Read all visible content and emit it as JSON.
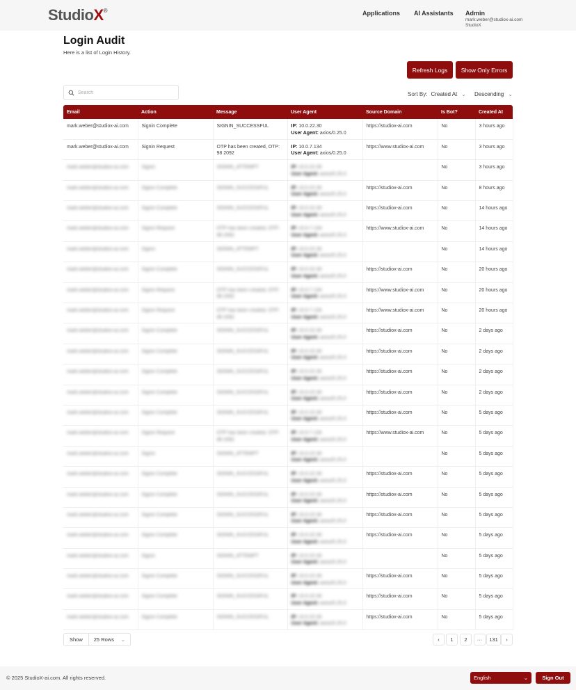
{
  "header": {
    "logo_main": "Studio",
    "logo_x": "X",
    "logo_mark": "®",
    "nav": [
      "Applications",
      "AI Assistants"
    ],
    "user": {
      "name": "Admin",
      "email": "mark.weber@studiox-ai.com",
      "org": "StudioX"
    }
  },
  "page": {
    "title": "Login Audit",
    "subtitle": "Here is a list of Login History.",
    "refresh_label": "Refresh Logs",
    "errors_label": "Show Only Errors",
    "search_placeholder": "Search",
    "sort_label": "Sort By:",
    "sort_field": "Created At",
    "sort_order": "Descending"
  },
  "table": {
    "columns": [
      "Email",
      "Action",
      "Message",
      "User Agent",
      "Source Domain",
      "Is Bot?",
      "Created At"
    ],
    "ip_label": "IP:",
    "ua_label": "User Agent:",
    "rows": [
      {
        "email": "mark.weber@studiox-ai.com",
        "action": "Signin Complete",
        "message": "SIGNIN_SUCCESSFUL",
        "ip": "10.0.22.30",
        "agent": "axios/0.25.0",
        "domain": "https://studiox-ai.com",
        "bot": "No",
        "created": "3 hours ago"
      },
      {
        "email": "mark.weber@studiox-ai.com",
        "action": "Signin Request",
        "message": "OTP has been created, OTP: 98 2092",
        "ip": "10.0.7.134",
        "agent": "axios/0.25.0",
        "domain": "https://www.studiox-ai.com",
        "bot": "No",
        "created": "3 hours ago"
      },
      {
        "email": "mark.weber@studiox-ai.com",
        "action": "Signin",
        "message": "SIGNIN_ATTEMPT",
        "ip": "10.0.22.30",
        "agent": "axios/0.25.0",
        "domain": "",
        "bot": "No",
        "created": "3 hours ago"
      },
      {
        "email": "mark.weber@studiox-ai.com",
        "action": "Signin Complete",
        "message": "SIGNIN_SUCCESSFUL",
        "ip": "10.0.22.30",
        "agent": "axios/0.25.0",
        "domain": "https://studiox-ai.com",
        "bot": "No",
        "created": "8 hours ago"
      },
      {
        "email": "mark.weber@studiox-ai.com",
        "action": "Signin Complete",
        "message": "SIGNIN_SUCCESSFUL",
        "ip": "10.0.22.30",
        "agent": "axios/0.25.0",
        "domain": "https://studiox-ai.com",
        "bot": "No",
        "created": "14 hours ago"
      },
      {
        "email": "mark.weber@studiox-ai.com",
        "action": "Signin Request",
        "message": "OTP has been created, OTP: 98 2092",
        "ip": "10.0.7.134",
        "agent": "axios/0.25.0",
        "domain": "https://www.studiox-ai.com",
        "bot": "No",
        "created": "14 hours ago"
      },
      {
        "email": "mark.weber@studiox-ai.com",
        "action": "Signin",
        "message": "SIGNIN_ATTEMPT",
        "ip": "10.0.22.30",
        "agent": "axios/0.25.0",
        "domain": "",
        "bot": "No",
        "created": "14 hours ago"
      },
      {
        "email": "mark.weber@studiox-ai.com",
        "action": "Signin Complete",
        "message": "SIGNIN_SUCCESSFUL",
        "ip": "10.0.22.30",
        "agent": "axios/0.25.0",
        "domain": "https://studiox-ai.com",
        "bot": "No",
        "created": "20 hours ago"
      },
      {
        "email": "mark.weber@studiox-ai.com",
        "action": "Signin Request",
        "message": "OTP has been created, OTP: 98 2092",
        "ip": "10.0.7.134",
        "agent": "axios/0.25.0",
        "domain": "https://www.studiox-ai.com",
        "bot": "No",
        "created": "20 hours ago"
      },
      {
        "email": "mark.weber@studiox-ai.com",
        "action": "Signin Request",
        "message": "OTP has been created, OTP: 98 2092",
        "ip": "10.0.7.134",
        "agent": "axios/0.25.0",
        "domain": "https://www.studiox-ai.com",
        "bot": "No",
        "created": "20 hours ago"
      },
      {
        "email": "mark.weber@studiox-ai.com",
        "action": "Signin Complete",
        "message": "SIGNIN_SUCCESSFUL",
        "ip": "10.0.22.30",
        "agent": "axios/0.25.0",
        "domain": "https://studiox-ai.com",
        "bot": "No",
        "created": "2 days ago"
      },
      {
        "email": "mark.weber@studiox-ai.com",
        "action": "Signin Complete",
        "message": "SIGNIN_SUCCESSFUL",
        "ip": "10.0.22.30",
        "agent": "axios/0.25.0",
        "domain": "https://studiox-ai.com",
        "bot": "No",
        "created": "2 days ago"
      },
      {
        "email": "mark.weber@studiox-ai.com",
        "action": "Signin Complete",
        "message": "SIGNIN_SUCCESSFUL",
        "ip": "10.0.22.30",
        "agent": "axios/0.25.0",
        "domain": "https://studiox-ai.com",
        "bot": "No",
        "created": "2 days ago"
      },
      {
        "email": "mark.weber@studiox-ai.com",
        "action": "Signin Complete",
        "message": "SIGNIN_SUCCESSFUL",
        "ip": "10.0.22.30",
        "agent": "axios/0.25.0",
        "domain": "https://studiox-ai.com",
        "bot": "No",
        "created": "2 days ago"
      },
      {
        "email": "mark.weber@studiox-ai.com",
        "action": "Signin Complete",
        "message": "SIGNIN_SUCCESSFUL",
        "ip": "10.0.22.30",
        "agent": "axios/0.25.0",
        "domain": "https://studiox-ai.com",
        "bot": "No",
        "created": "5 days ago"
      },
      {
        "email": "mark.weber@studiox-ai.com",
        "action": "Signin Request",
        "message": "OTP has been created, OTP: 98 2092",
        "ip": "10.0.7.134",
        "agent": "axios/0.25.0",
        "domain": "https://www.studiox-ai.com",
        "bot": "No",
        "created": "5 days ago"
      },
      {
        "email": "mark.weber@studiox-ai.com",
        "action": "Signin",
        "message": "SIGNIN_ATTEMPT",
        "ip": "10.0.22.30",
        "agent": "axios/0.25.0",
        "domain": "",
        "bot": "No",
        "created": "5 days ago"
      },
      {
        "email": "mark.weber@studiox-ai.com",
        "action": "Signin Complete",
        "message": "SIGNIN_SUCCESSFUL",
        "ip": "10.0.22.30",
        "agent": "axios/0.25.0",
        "domain": "https://studiox-ai.com",
        "bot": "No",
        "created": "5 days ago"
      },
      {
        "email": "mark.weber@studiox-ai.com",
        "action": "Signin Complete",
        "message": "SIGNIN_SUCCESSFUL",
        "ip": "10.0.22.30",
        "agent": "axios/0.25.0",
        "domain": "https://studiox-ai.com",
        "bot": "No",
        "created": "5 days ago"
      },
      {
        "email": "mark.weber@studiox-ai.com",
        "action": "Signin Complete",
        "message": "SIGNIN_SUCCESSFUL",
        "ip": "10.0.22.30",
        "agent": "axios/0.25.0",
        "domain": "https://studiox-ai.com",
        "bot": "No",
        "created": "5 days ago"
      },
      {
        "email": "mark.weber@studiox-ai.com",
        "action": "Signin Complete",
        "message": "SIGNIN_SUCCESSFUL",
        "ip": "10.0.22.30",
        "agent": "axios/0.25.0",
        "domain": "https://studiox-ai.com",
        "bot": "No",
        "created": "5 days ago"
      },
      {
        "email": "mark.weber@studiox-ai.com",
        "action": "Signin",
        "message": "SIGNIN_ATTEMPT",
        "ip": "10.0.22.30",
        "agent": "axios/0.25.0",
        "domain": "",
        "bot": "No",
        "created": "5 days ago"
      },
      {
        "email": "mark.weber@studiox-ai.com",
        "action": "Signin Complete",
        "message": "SIGNIN_SUCCESSFUL",
        "ip": "10.0.22.30",
        "agent": "axios/0.25.0",
        "domain": "https://studiox-ai.com",
        "bot": "No",
        "created": "5 days ago"
      },
      {
        "email": "mark.weber@studiox-ai.com",
        "action": "Signin Complete",
        "message": "SIGNIN_SUCCESSFUL",
        "ip": "10.0.22.30",
        "agent": "axios/0.25.0",
        "domain": "https://studiox-ai.com",
        "bot": "No",
        "created": "5 days ago"
      },
      {
        "email": "mark.weber@studiox-ai.com",
        "action": "Signin Complete",
        "message": "SIGNIN_SUCCESSFUL",
        "ip": "10.0.22.30",
        "agent": "axios/0.25.0",
        "domain": "https://studiox-ai.com",
        "bot": "No",
        "created": "5 days ago"
      }
    ]
  },
  "pagination": {
    "show_label": "Show",
    "rows_value": "25 Rows",
    "prev": "‹",
    "pages": [
      "1",
      "2"
    ],
    "ellipsis": "···",
    "last": "131",
    "next": "›"
  },
  "footer": {
    "copyright": "© 2025 StudioX-ai.com.  All rights reserved.",
    "language": "English",
    "signout_label": "Sign Out"
  },
  "colors": {
    "accent": "#8f0d0d"
  }
}
